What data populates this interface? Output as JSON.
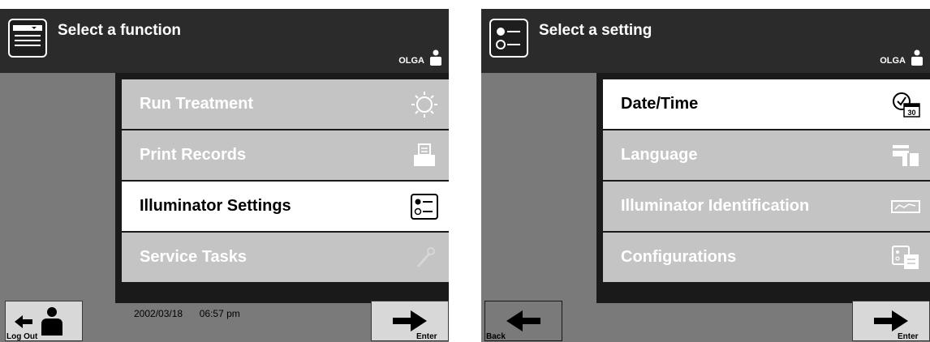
{
  "left": {
    "title": "Select a function",
    "user": "OLGA",
    "menu": [
      {
        "label": "Run Treatment",
        "icon": "illumination-icon",
        "active": false
      },
      {
        "label": "Print Records",
        "icon": "printer-icon",
        "active": false
      },
      {
        "label": "Illuminator Settings",
        "icon": "settings-list-icon",
        "active": true
      },
      {
        "label": "Service Tasks",
        "icon": "wrench-icon",
        "active": false
      }
    ],
    "bottom_left_label": "Log Out",
    "bottom_right_label": "Enter",
    "date": "2002/03/18",
    "time": "06:57 pm"
  },
  "right": {
    "title": "Select a setting",
    "user": "OLGA",
    "menu": [
      {
        "label": "Date/Time",
        "icon": "clock-calendar-icon",
        "badge": "30",
        "active": true
      },
      {
        "label": "Language",
        "icon": "language-flags-icon",
        "active": false
      },
      {
        "label": "Illuminator Identification",
        "icon": "illuminator-id-icon",
        "active": false
      },
      {
        "label": "Configurations",
        "icon": "configurations-icon",
        "active": false
      }
    ],
    "bottom_left_label": "Back",
    "bottom_right_label": "Enter"
  },
  "colors": {
    "header": "#2b2b2b",
    "background": "#7a7a7a",
    "menu_item": "#c4c4c4",
    "menu_active": "#ffffff"
  }
}
